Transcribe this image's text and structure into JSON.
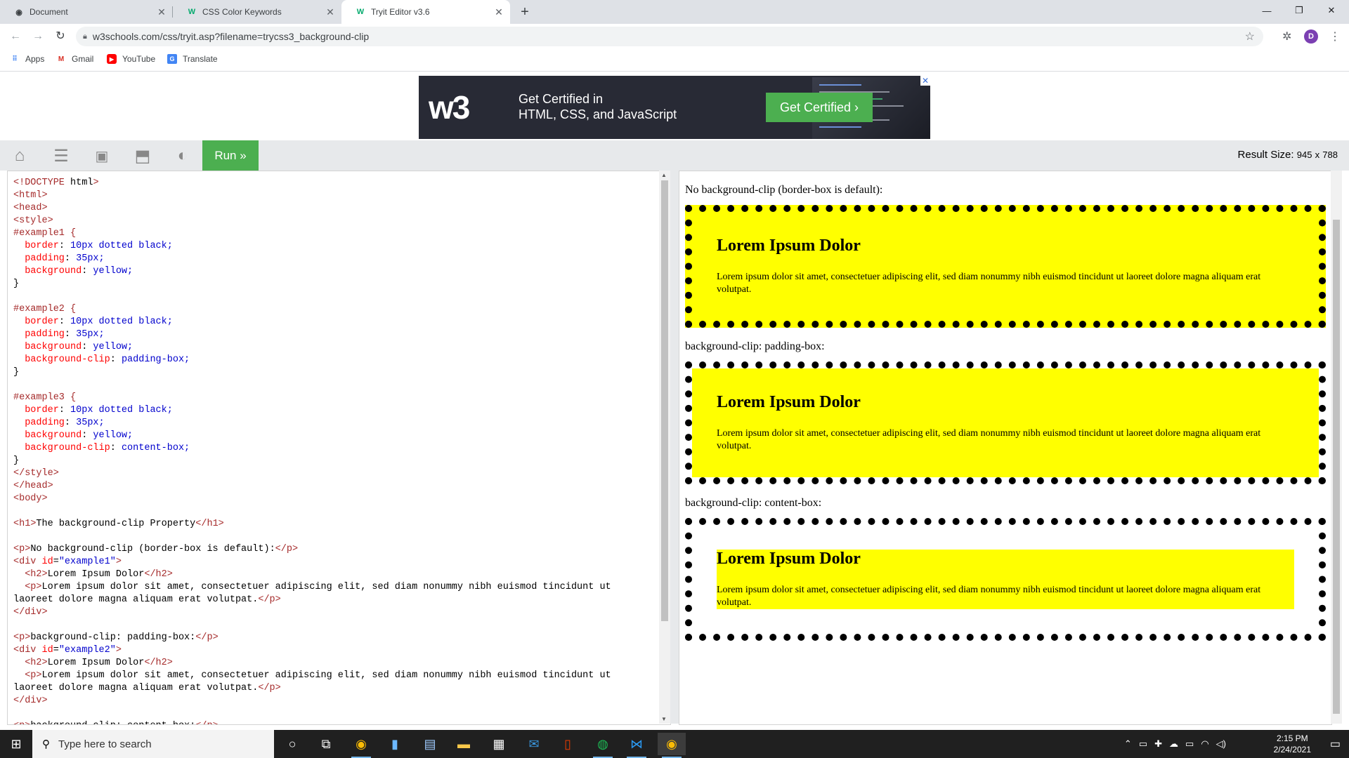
{
  "browser": {
    "tabs": [
      {
        "title": "Document",
        "favicon": "globe-icon"
      },
      {
        "title": "CSS Color Keywords",
        "favicon": "w3schools-icon"
      },
      {
        "title": "Tryit Editor v3.6",
        "favicon": "w3schools-icon",
        "active": true
      }
    ],
    "url": "w3schools.com/css/tryit.asp?filename=trycss3_background-clip",
    "profile_initial": "D",
    "bookmarks": [
      {
        "label": "Apps",
        "icon": "apps-grid-icon"
      },
      {
        "label": "Gmail",
        "icon": "gmail-icon"
      },
      {
        "label": "YouTube",
        "icon": "youtube-icon"
      },
      {
        "label": "Translate",
        "icon": "translate-icon"
      }
    ]
  },
  "ad": {
    "line1": "Get Certified in",
    "line2": "HTML, CSS, and JavaScript",
    "cta": "Get Certified ›",
    "logo": "w3"
  },
  "toolbar": {
    "run_label": "Run »",
    "result_size_label": "Result Size:",
    "result_width": "945",
    "result_x": "x",
    "result_height": "788"
  },
  "code_lines": [
    "<!DOCTYPE html>",
    "<html>",
    "<head>",
    "<style>",
    "#example1 {",
    "  border: 10px dotted black;",
    "  padding: 35px;",
    "  background: yellow;",
    "}",
    "",
    "#example2 {",
    "  border: 10px dotted black;",
    "  padding: 35px;",
    "  background: yellow;",
    "  background-clip: padding-box;",
    "}",
    "",
    "#example3 {",
    "  border: 10px dotted black;",
    "  padding: 35px;",
    "  background: yellow;",
    "  background-clip: content-box;",
    "}",
    "</style>",
    "</head>",
    "<body>",
    "",
    "<h1>The background-clip Property</h1>",
    "",
    "<p>No background-clip (border-box is default):</p>",
    "<div id=\"example1\">",
    "  <h2>Lorem Ipsum Dolor</h2>",
    "  <p>Lorem ipsum dolor sit amet, consectetuer adipiscing elit, sed diam nonummy nibh euismod tincidunt ut",
    "laoreet dolore magna aliquam erat volutpat.</p>",
    "</div>",
    "",
    "<p>background-clip: padding-box:</p>",
    "<div id=\"example2\">",
    "  <h2>Lorem Ipsum Dolor</h2>",
    "  <p>Lorem ipsum dolor sit amet, consectetuer adipiscing elit, sed diam nonummy nibh euismod tincidunt ut",
    "laoreet dolore magna aliquam erat volutpat.</p>",
    "</div>",
    "",
    "<p>background-clip: content-box:</p>"
  ],
  "result": {
    "p1": "No background-clip (border-box is default):",
    "p2": "background-clip: padding-box:",
    "p3": "background-clip: content-box:",
    "heading": "Lorem Ipsum Dolor",
    "body": "Lorem ipsum dolor sit amet, consectetuer adipiscing elit, sed diam nonummy nibh euismod tincidunt ut laoreet dolore magna aliquam erat volutpat."
  },
  "taskbar": {
    "search_placeholder": "Type here to search",
    "time": "2:15 PM",
    "date": "2/24/2021"
  },
  "colors": {
    "run_green": "#4caf50",
    "example_bg": "#ffff00",
    "ad_bg": "#282a35"
  }
}
